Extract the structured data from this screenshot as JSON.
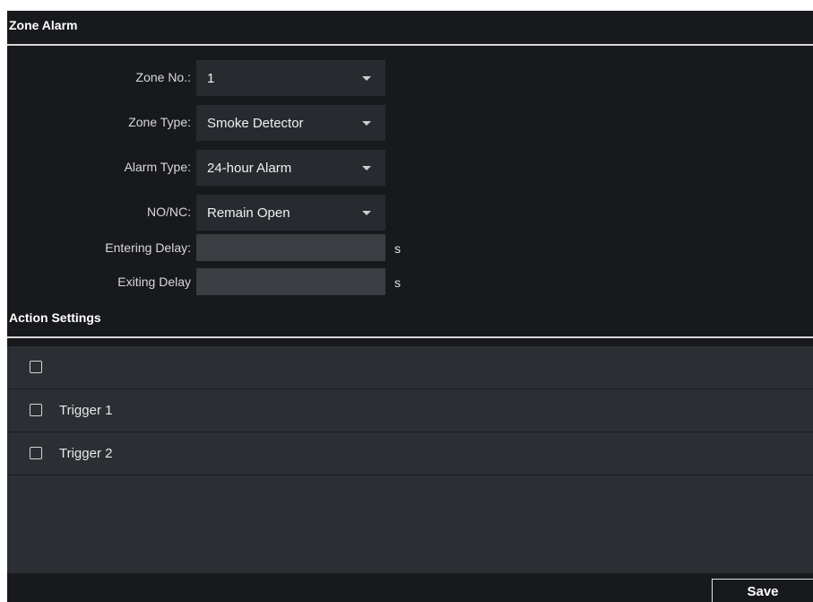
{
  "zone_alarm": {
    "title": "Zone Alarm",
    "fields": {
      "zone_no": {
        "label": "Zone No.:",
        "value": "1"
      },
      "zone_type": {
        "label": "Zone Type:",
        "value": "Smoke Detector"
      },
      "alarm_type": {
        "label": "Alarm Type:",
        "value": "24-hour Alarm"
      },
      "no_nc": {
        "label": "NO/NC:",
        "value": "Remain Open"
      },
      "entering_delay": {
        "label": "Entering Delay:",
        "value": "",
        "unit": "s"
      },
      "exiting_delay": {
        "label": "Exiting Delay",
        "value": "",
        "unit": "s"
      }
    }
  },
  "action_settings": {
    "title": "Action Settings",
    "rows": [
      {
        "label": "",
        "checked": false
      },
      {
        "label": "Trigger 1",
        "checked": false
      },
      {
        "label": "Trigger 2",
        "checked": false
      }
    ]
  },
  "footer": {
    "save_label": "Save"
  },
  "colors": {
    "panel_background": "#17191c",
    "select_background": "#272a2f",
    "input_background": "#3a3d42",
    "table_background": "#2b2e33",
    "rule": "#d8d8d8"
  },
  "icons": {
    "dropdown": "chevron-down-icon",
    "checkbox": "checkbox-icon"
  }
}
